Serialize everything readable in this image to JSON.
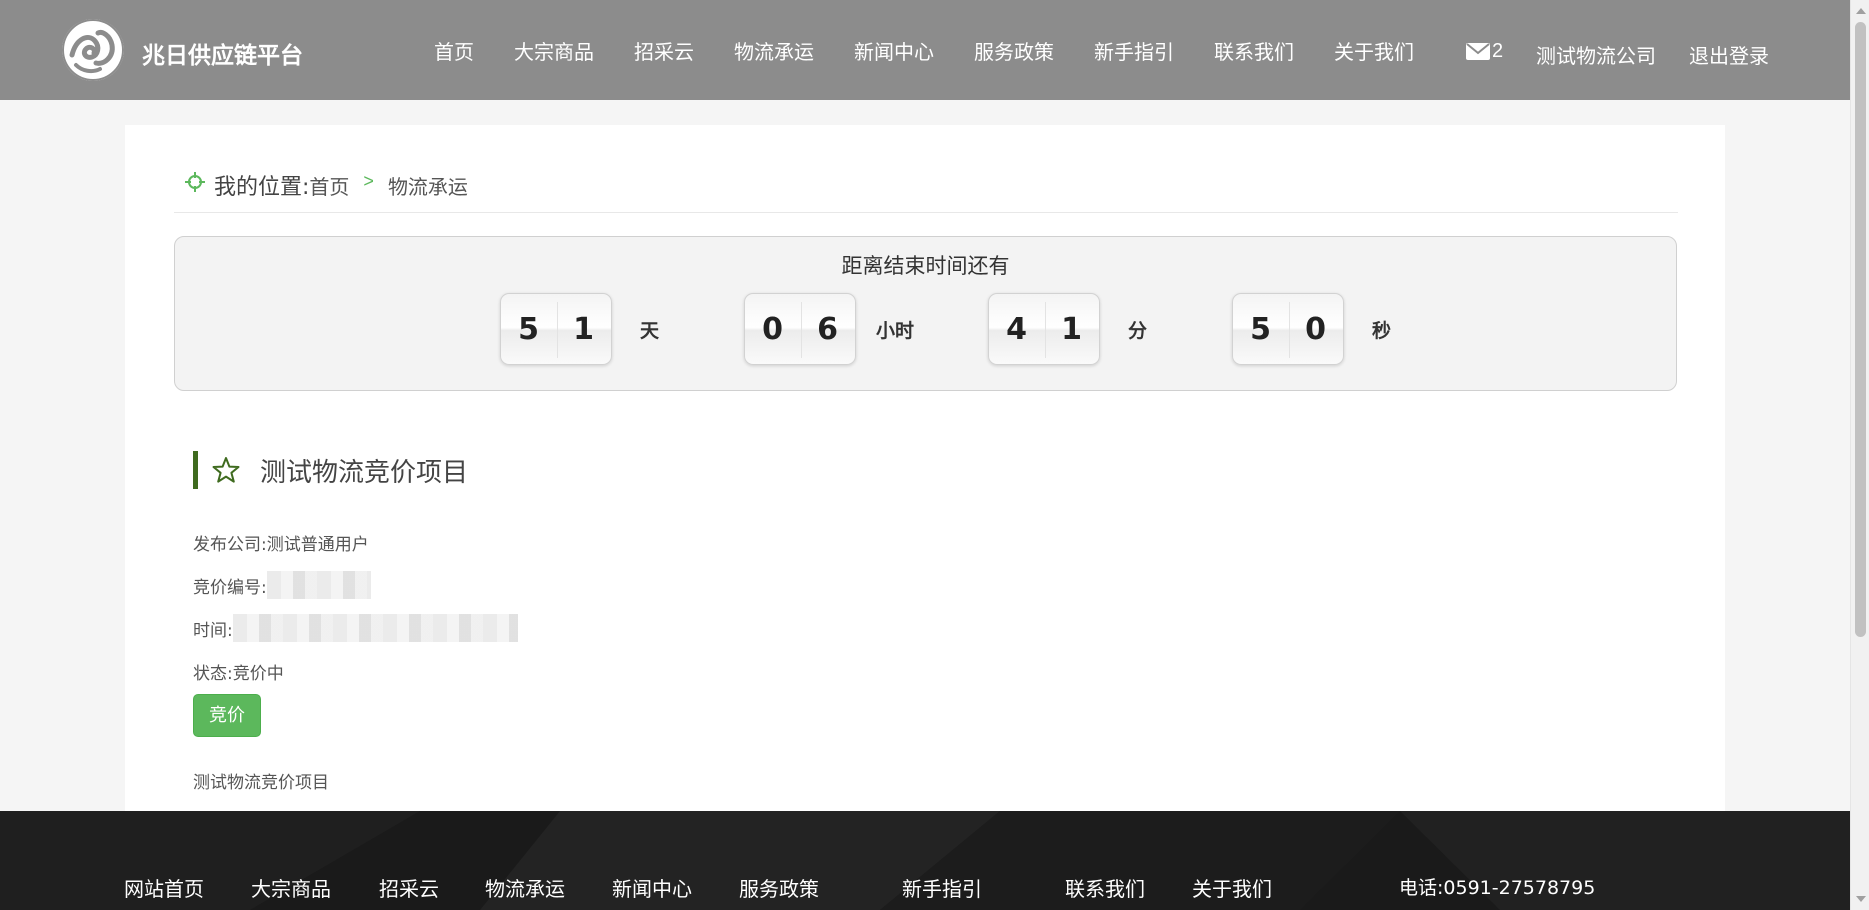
{
  "header": {
    "brand": "兆日供应链平台",
    "nav": [
      "首页",
      "大宗商品",
      "招采云",
      "物流承运",
      "新闻中心",
      "服务政策",
      "新手指引",
      "联系我们",
      "关于我们"
    ],
    "mail_count": "2",
    "company": "测试物流公司",
    "logout": "退出登录"
  },
  "breadcrumb": {
    "prefix": "我的位置:",
    "home": "首页",
    "separator": ">",
    "current": "物流承运"
  },
  "countdown": {
    "title": "距离结束时间还有",
    "units": [
      {
        "digits": [
          "5",
          "1"
        ],
        "label": "天"
      },
      {
        "digits": [
          "0",
          "6"
        ],
        "label": "小时"
      },
      {
        "digits": [
          "4",
          "1"
        ],
        "label": "分"
      },
      {
        "digits": [
          "5",
          "0"
        ],
        "label": "秒"
      }
    ]
  },
  "project": {
    "title": "测试物流竞价项目",
    "publisher_label": "发布公司:",
    "publisher_value": "测试普通用户",
    "bid_no_label": "竞价编号:",
    "time_label": "时间:",
    "status_label": "状态:",
    "status_value": "竞价中",
    "bid_button": "竞价",
    "description": "测试物流竞价项目"
  },
  "footer": {
    "nav": [
      "网站首页",
      "大宗商品",
      "招采云",
      "物流承运",
      "新闻中心",
      "服务政策",
      "新手指引",
      "联系我们",
      "关于我们"
    ],
    "phone": "电话:0591-27578795"
  },
  "colors": {
    "header_bg": "#8c8c8c",
    "accent_green": "#5cb85c",
    "title_bar": "#3f6b1f",
    "footer_bg": "#1a1a1a"
  }
}
